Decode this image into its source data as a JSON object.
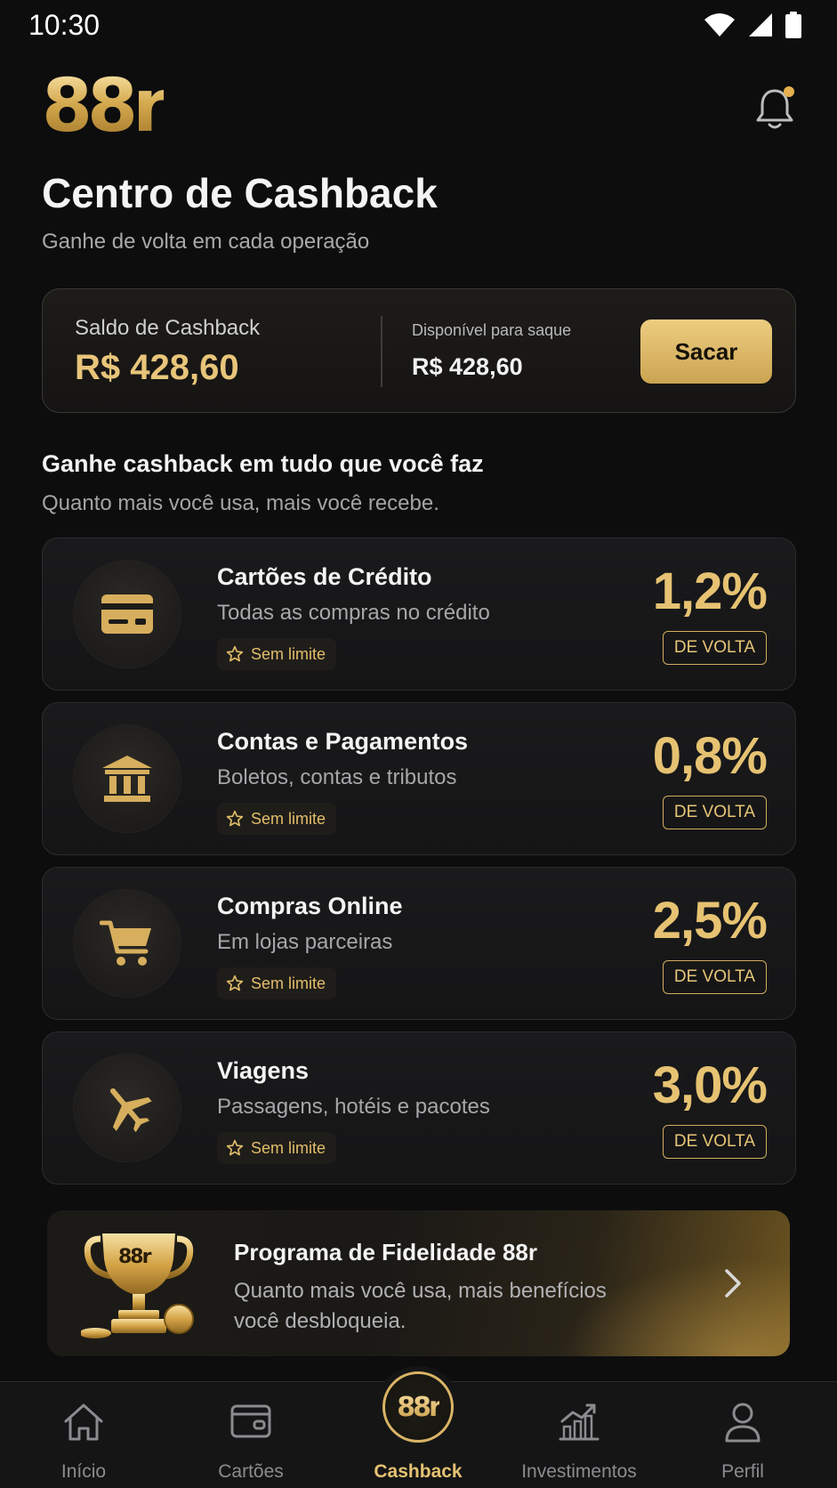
{
  "status_bar": {
    "time": "10:30"
  },
  "header": {
    "logo_text": "88r",
    "accent_color": "#e6c272"
  },
  "page": {
    "title": "Centro de Cashback",
    "subtitle": "Ganhe de volta em cada operação"
  },
  "balance": {
    "label": "Saldo de Cashback",
    "value": "R$ 428,60",
    "available_label": "Disponível para saque",
    "available_value": "R$ 428,60",
    "withdraw_label": "Sacar"
  },
  "section": {
    "title": "Ganhe cashback em tudo que você faz",
    "subtitle": "Quanto mais você usa, mais você recebe."
  },
  "categories": [
    {
      "icon": "credit-card-icon",
      "title": "Cartões de Crédito",
      "description": "Todas as compras no crédito",
      "tag": "Sem limite",
      "rate": "1,2%",
      "badge": "DE VOLTA"
    },
    {
      "icon": "bank-icon",
      "title": "Contas e Pagamentos",
      "description": "Boletos, contas e tributos",
      "tag": "Sem limite",
      "rate": "0,8%",
      "badge": "DE VOLTA"
    },
    {
      "icon": "shopping-cart-icon",
      "title": "Compras Online",
      "description": "Em lojas parceiras",
      "tag": "Sem limite",
      "rate": "2,5%",
      "badge": "DE VOLTA"
    },
    {
      "icon": "airplane-icon",
      "title": "Viagens",
      "description": "Passagens, hotéis e pacotes",
      "tag": "Sem limite",
      "rate": "3,0%",
      "badge": "DE VOLTA"
    }
  ],
  "loyalty": {
    "icon": "trophy-icon",
    "trophy_text": "88r",
    "title": "Programa de Fidelidade 88r",
    "description": "Quanto mais você usa, mais benefícios você desbloqueia."
  },
  "bottom_nav": {
    "items": [
      {
        "label": "Início",
        "icon": "home-icon"
      },
      {
        "label": "Cartões",
        "icon": "wallet-card-icon"
      },
      {
        "label": "Cashback",
        "icon": "cashback-logo-icon",
        "logo_text": "88r",
        "active": true
      },
      {
        "label": "Investimentos",
        "icon": "chart-growth-icon"
      },
      {
        "label": "Perfil",
        "icon": "user-icon"
      }
    ]
  }
}
